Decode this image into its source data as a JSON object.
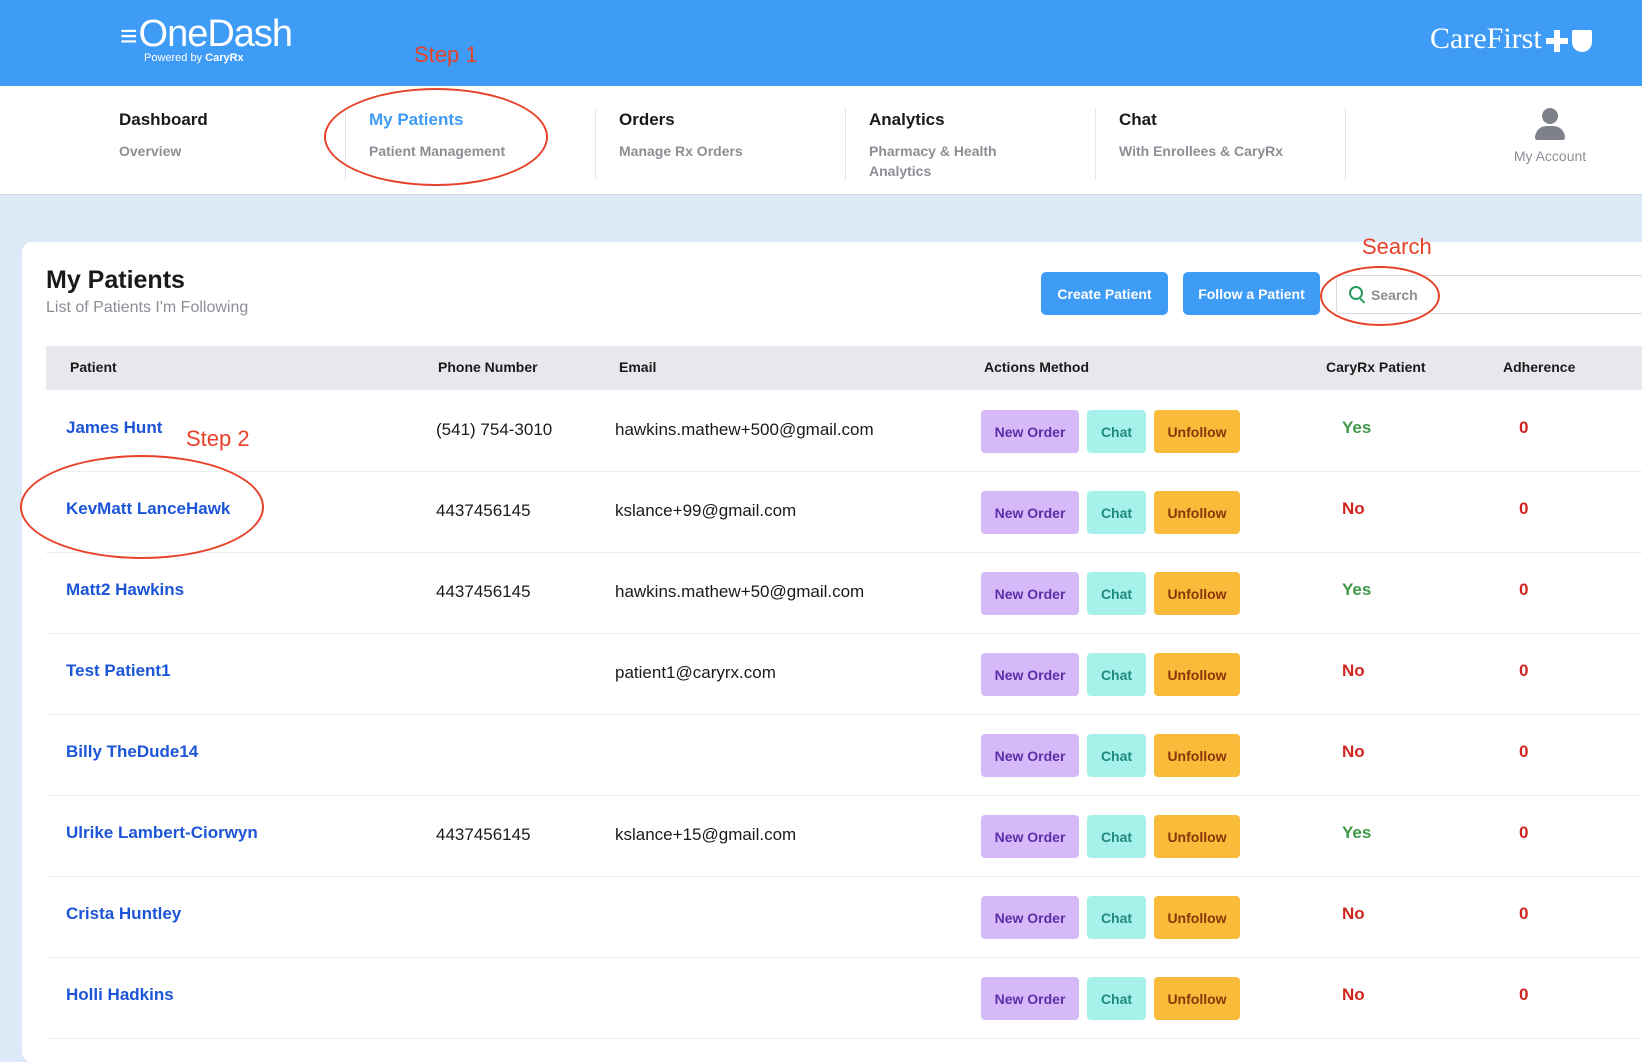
{
  "header": {
    "logo_main": "OneDash",
    "logo_powered": "Powered by",
    "logo_powered_brand": "CaryRx",
    "brand": "CareFirst"
  },
  "nav": {
    "items": [
      {
        "title": "Dashboard",
        "subtitle": "Overview"
      },
      {
        "title": "My Patients",
        "subtitle": "Patient Management"
      },
      {
        "title": "Orders",
        "subtitle": "Manage Rx Orders"
      },
      {
        "title": "Analytics",
        "subtitle": "Pharmacy & Health Analytics"
      },
      {
        "title": "Chat",
        "subtitle": "With Enrollees & CaryRx"
      }
    ],
    "active_index": 1,
    "account_label": "My Account"
  },
  "page": {
    "title": "My Patients",
    "subtitle": "List of Patients I'm Following",
    "create_button": "Create Patient",
    "follow_button": "Follow a Patient",
    "search_placeholder": "Search"
  },
  "table": {
    "columns": [
      "Patient",
      "Phone Number",
      "Email",
      "Actions Method",
      "CaryRx Patient",
      "Adherence"
    ],
    "action_labels": {
      "new_order": "New Order",
      "chat": "Chat",
      "unfollow": "Unfollow"
    },
    "rows": [
      {
        "name": "James Hunt",
        "phone": "(541) 754-3010",
        "email": "hawkins.mathew+500@gmail.com",
        "caryrx": "Yes",
        "adherence": "0"
      },
      {
        "name": "KevMatt LanceHawk",
        "phone": "4437456145",
        "email": "kslance+99@gmail.com",
        "caryrx": "No",
        "adherence": "0"
      },
      {
        "name": "Matt2 Hawkins",
        "phone": "4437456145",
        "email": "hawkins.mathew+50@gmail.com",
        "caryrx": "Yes",
        "adherence": "0"
      },
      {
        "name": "Test Patient1",
        "phone": "",
        "email": "patient1@caryrx.com",
        "caryrx": "No",
        "adherence": "0"
      },
      {
        "name": "Billy TheDude14",
        "phone": "",
        "email": "",
        "caryrx": "No",
        "adherence": "0"
      },
      {
        "name": "Ulrike Lambert-Ciorwyn",
        "phone": "4437456145",
        "email": "kslance+15@gmail.com",
        "caryrx": "Yes",
        "adherence": "0"
      },
      {
        "name": "Crista Huntley",
        "phone": "",
        "email": "",
        "caryrx": "No",
        "adherence": "0"
      },
      {
        "name": "Holli Hadkins",
        "phone": "",
        "email": "",
        "caryrx": "No",
        "adherence": "0"
      }
    ]
  },
  "annotations": {
    "step1": "Step 1",
    "step2": "Step 2",
    "search": "Search",
    "color": "#e8412a"
  },
  "colors": {
    "brand_blue": "#3e9bf6",
    "link_blue": "#1d55d8",
    "yes_green": "#3f9a48",
    "no_red": "#d0251f"
  }
}
